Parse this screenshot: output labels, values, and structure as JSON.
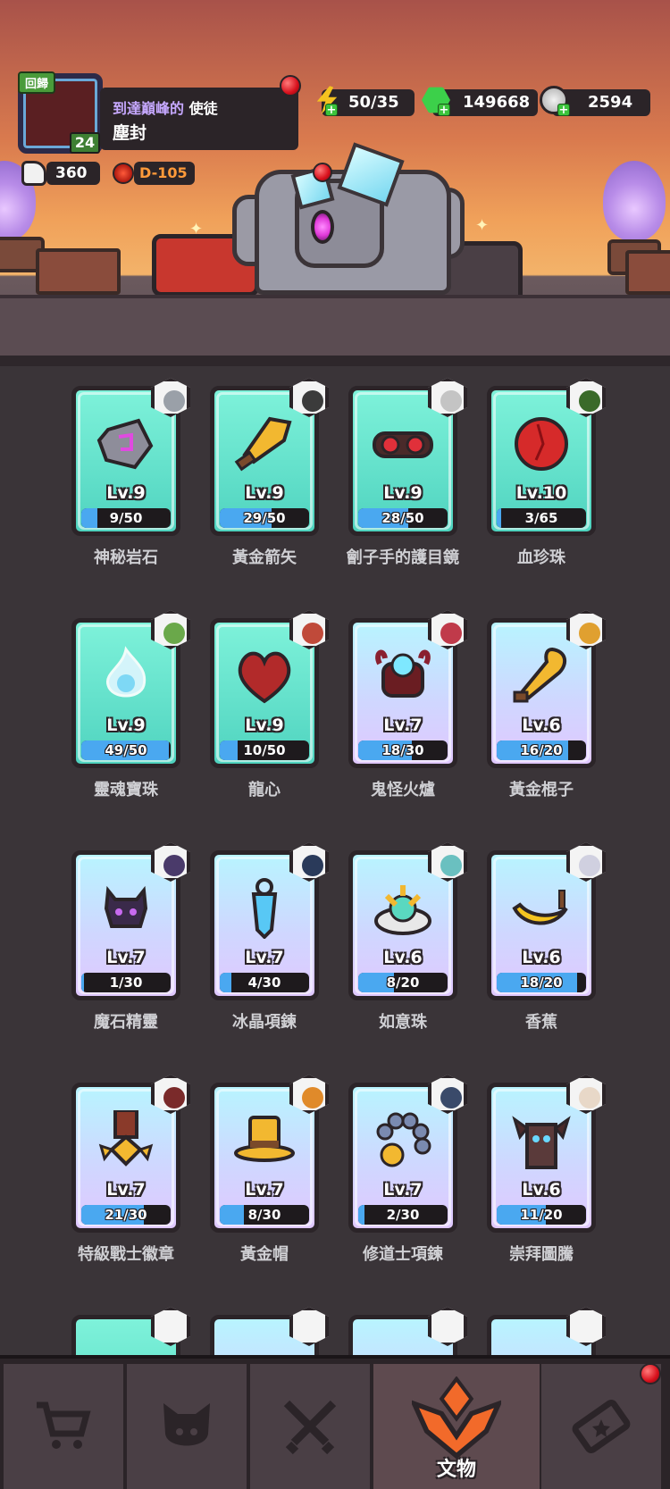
{
  "profile": {
    "review_tag": "回歸",
    "level": "24",
    "title_prefix": "到達巔峰的",
    "title_suffix": "使徒",
    "name": "塵封",
    "likes": "360",
    "dungeon": "D-105"
  },
  "resources": {
    "energy": "50/35",
    "gems": "149668",
    "coins": "2594"
  },
  "relics": [
    {
      "name": "神秘岩石",
      "level": "Lv.9",
      "progress": "9/50",
      "fill": 0.18,
      "card": "teal",
      "art": "rock",
      "portrait": "#9aa0a8"
    },
    {
      "name": "黃金箭矢",
      "level": "Lv.9",
      "progress": "29/50",
      "fill": 0.58,
      "card": "teal",
      "art": "arrow",
      "portrait": "#3b3b3b"
    },
    {
      "name": "劊子手的護目鏡",
      "level": "Lv.9",
      "progress": "28/50",
      "fill": 0.56,
      "card": "teal",
      "art": "goggles",
      "portrait": "#c4c4c4"
    },
    {
      "name": "血珍珠",
      "level": "Lv.10",
      "progress": "3/65",
      "fill": 0.05,
      "card": "teal",
      "art": "pearl",
      "portrait": "#3a6a2a"
    },
    {
      "name": "靈魂寶珠",
      "level": "Lv.9",
      "progress": "49/50",
      "fill": 0.98,
      "card": "teal",
      "art": "soul",
      "portrait": "#6aa84a"
    },
    {
      "name": "龍心",
      "level": "Lv.9",
      "progress": "10/50",
      "fill": 0.2,
      "card": "teal",
      "art": "heart",
      "portrait": "#c04a3a"
    },
    {
      "name": "鬼怪火爐",
      "level": "Lv.7",
      "progress": "18/30",
      "fill": 0.6,
      "card": "blue",
      "art": "furnace",
      "portrait": "#c03a4a"
    },
    {
      "name": "黃金棍子",
      "level": "Lv.6",
      "progress": "16/20",
      "fill": 0.8,
      "card": "blue",
      "art": "club",
      "portrait": "#e0a030"
    },
    {
      "name": "魔石精靈",
      "level": "Lv.7",
      "progress": "1/30",
      "fill": 0.03,
      "card": "blue",
      "art": "spirit",
      "portrait": "#4a3a6a"
    },
    {
      "name": "冰晶項鍊",
      "level": "Lv.7",
      "progress": "4/30",
      "fill": 0.13,
      "card": "blue",
      "art": "crystal",
      "portrait": "#2a3a5a"
    },
    {
      "name": "如意珠",
      "level": "Lv.6",
      "progress": "8/20",
      "fill": 0.4,
      "card": "blue",
      "art": "claw",
      "portrait": "#6ac0c0"
    },
    {
      "name": "香蕉",
      "level": "Lv.6",
      "progress": "18/20",
      "fill": 0.9,
      "card": "blue",
      "art": "banana",
      "portrait": "#d0d0e0"
    },
    {
      "name": "特級戰士徽章",
      "level": "Lv.7",
      "progress": "21/30",
      "fill": 0.7,
      "card": "blue",
      "art": "medal",
      "portrait": "#7a2a2a"
    },
    {
      "name": "黃金帽",
      "level": "Lv.7",
      "progress": "8/30",
      "fill": 0.27,
      "card": "blue",
      "art": "hat",
      "portrait": "#e08a2a"
    },
    {
      "name": "修道士項鍊",
      "level": "Lv.7",
      "progress": "2/30",
      "fill": 0.07,
      "card": "blue",
      "art": "beads",
      "portrait": "#3a4a6a"
    },
    {
      "name": "崇拜圖騰",
      "level": "Lv.6",
      "progress": "11/20",
      "fill": 0.55,
      "card": "blue",
      "art": "totem",
      "portrait": "#e8d8c8"
    }
  ],
  "nav": {
    "tabs": [
      {
        "id": "shop",
        "icon": "cart-icon",
        "label": ""
      },
      {
        "id": "pets",
        "icon": "pet-icon",
        "label": ""
      },
      {
        "id": "battle",
        "icon": "crossed-swords-icon",
        "label": ""
      },
      {
        "id": "relics",
        "icon": "relic-emblem-icon",
        "label": "文物"
      },
      {
        "id": "pass",
        "icon": "ticket-icon",
        "label": ""
      }
    ]
  },
  "colors": {
    "card_teal": "#4fd3bf",
    "card_blue": "#cfd7ff",
    "progress_fill": "#4aa8f0",
    "accent_red": "#d8101c"
  }
}
